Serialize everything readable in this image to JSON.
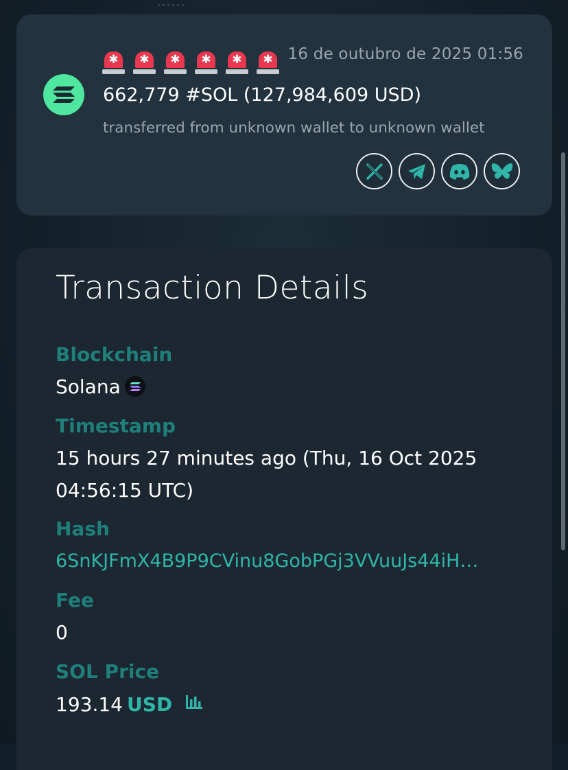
{
  "alert": {
    "date": "16 de outubro de 2025 01:56",
    "amount": "662,779 #SOL (127,984,609 USD)",
    "description": "transferred from unknown wallet to unknown wallet",
    "siren_count": 6,
    "coin_icon": "solana-logo-icon",
    "share_buttons": [
      "x-icon",
      "telegram-icon",
      "discord-icon",
      "bluesky-icon"
    ]
  },
  "details": {
    "title": "Transaction Details",
    "blockchain_label": "Blockchain",
    "blockchain_value": "Solana",
    "timestamp_label": "Timestamp",
    "timestamp_value": "15 hours 27 minutes ago (Thu, 16 Oct 2025 04:56:15 UTC)",
    "hash_label": "Hash",
    "hash_value": "6SnKJFmX4B9P9CVinu8GobPGj3VVuuJs44iH…",
    "fee_label": "Fee",
    "fee_value": "0",
    "price_label": "SOL Price",
    "price_value": "193.14",
    "price_currency": "USD"
  },
  "colors": {
    "background": "#142029",
    "alert_card": "#22323e",
    "details_card": "#1c2731",
    "label_teal": "#1f7f7a",
    "link_teal": "#2fb6a9",
    "solana_green": "#4fe6a0",
    "siren_red": "#e8384f"
  }
}
